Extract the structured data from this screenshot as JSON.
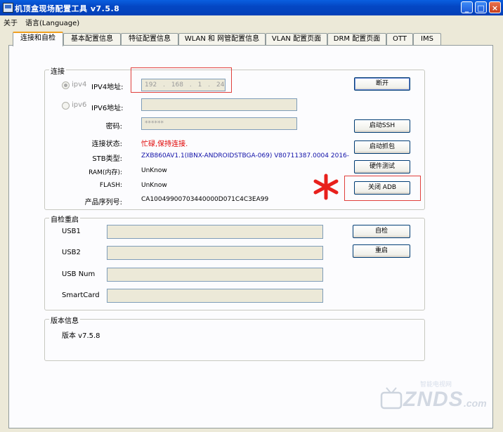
{
  "window": {
    "title": "机顶盒现场配置工具 v7.5.8",
    "buttons": [
      "minimize",
      "maximize",
      "close"
    ]
  },
  "menu": {
    "items": [
      {
        "label": "关于"
      },
      {
        "label": "语言(Language)"
      }
    ]
  },
  "tabs": [
    {
      "label": "连接和自检",
      "active": true
    },
    {
      "label": "基本配置信息"
    },
    {
      "label": "特征配置信息"
    },
    {
      "label": "WLAN 和 网管配置信息"
    },
    {
      "label": "VLAN 配置页面"
    },
    {
      "label": "DRM 配置页面"
    },
    {
      "label": "OTT"
    },
    {
      "label": "IMS"
    }
  ],
  "connect": {
    "legend": "连接",
    "ipv4_radio": "ipv4",
    "ipv4_label": "IPV4地址:",
    "ipv4_octets": [
      "192",
      "168",
      "1",
      "245"
    ],
    "ipv6_radio": "ipv6",
    "ipv6_label": "IPV6地址:",
    "ipv6_value": "",
    "password_label": "密码:",
    "password_value": "******",
    "status_label": "连接状态:",
    "status_value": "忙碌,保持连接.",
    "stb_type_label": "STB类型:",
    "stb_type_value": "ZXB860AV1.1(IBNX-ANDROIDSTBGA-069) V80711387.0004 2016-",
    "ram_label": "RAM(内存):",
    "ram_value": "UnKnow",
    "flash_label": "FLASH:",
    "flash_value": "UnKnow",
    "serial_label": "产品序列号:",
    "serial_value": "CA10049900703440000D071C4C3EA99",
    "buttons": {
      "disconnect": "断开",
      "start_ssh": "启动SSH",
      "start_capture": "启动抓包",
      "hardware_test": "硬件测试",
      "close_adb": "关闭 ADB"
    }
  },
  "selfcheck": {
    "legend": "自检重启",
    "usb1_label": "USB1",
    "usb2_label": "USB2",
    "usbnum_label": "USB Num",
    "smartcard_label": "SmartCard",
    "selfcheck_button": "自检",
    "restart_button": "重启"
  },
  "version": {
    "legend": "版本信息",
    "text": "版本 v7.5.8"
  },
  "watermark": {
    "brand": "ZNDS",
    "suffix": ".com",
    "tagline": "智能电视网"
  },
  "colors": {
    "status_red": "#e00000",
    "stb_blue": "#1010a8",
    "annotation_red": "#e0403c",
    "titlebar_blue": "#0447c4"
  }
}
